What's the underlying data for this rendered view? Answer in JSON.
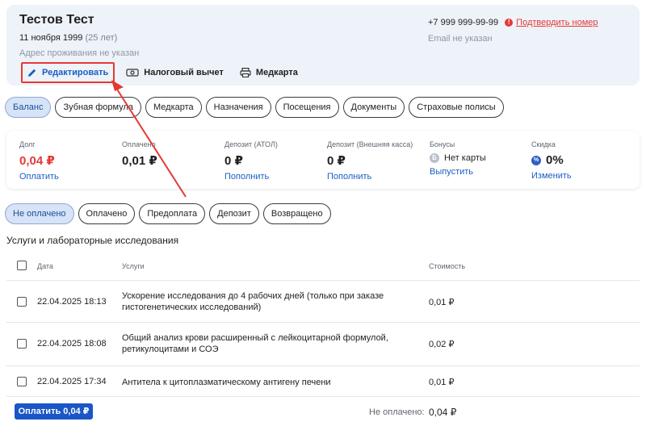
{
  "patient": {
    "name": "Тестов Тест",
    "dob": "11 ноября 1999",
    "age": "(25 лет)",
    "address": "Адрес проживания не указан",
    "phone": "+7 999 999-99-99",
    "confirm_phone": "Подтвердить номер",
    "email": "Email не указан"
  },
  "actions": {
    "edit": "Редактировать",
    "tax": "Налоговый вычет",
    "medcard": "Медкарта"
  },
  "tabs": [
    "Баланс",
    "Зубная формула",
    "Медкарта",
    "Назначения",
    "Посещения",
    "Документы",
    "Страховые полисы"
  ],
  "balance": {
    "debt": {
      "label": "Долг",
      "value": "0,04 ₽",
      "link": "Оплатить"
    },
    "paid": {
      "label": "Оплачено",
      "value": "0,01 ₽"
    },
    "deposit_atol": {
      "label": "Депозит (АТОЛ)",
      "value": "0 ₽",
      "link": "Пополнить"
    },
    "deposit_ext": {
      "label": "Депозит (Внешняя касса)",
      "value": "0 ₽",
      "link": "Пополнить"
    },
    "bonuses": {
      "label": "Бонусы",
      "value": "Нет карты",
      "link": "Выпустить"
    },
    "discount": {
      "label": "Скидка",
      "value": "0%",
      "link": "Изменить"
    }
  },
  "filters": [
    "Не оплачено",
    "Оплачено",
    "Предоплата",
    "Депозит",
    "Возвращено"
  ],
  "section_title": "Услуги и лабораторные исследования",
  "table": {
    "headers": {
      "date": "Дата",
      "services": "Услуги",
      "cost": "Стоимость"
    },
    "rows": [
      {
        "date": "22.04.2025 18:13",
        "service": "Ускорение исследования до 4 рабочих дней (только при заказе гистогенетических исследований)",
        "cost": "0,01 ₽"
      },
      {
        "date": "22.04.2025 18:08",
        "service": "Общий анализ крови расширенный с лейкоцитарной формулой, ретикулоцитами и СОЭ",
        "cost": "0,02 ₽"
      },
      {
        "date": "22.04.2025 17:34",
        "service": "Антитела к цитоплазматическому антигену печени",
        "cost": "0,01 ₽"
      }
    ]
  },
  "footer": {
    "pay_button": "Оплатить 0,04 ₽",
    "unpaid_label": "Не оплачено:",
    "unpaid_value": "0,04 ₽"
  },
  "colors": {
    "accent": "#1a56c6",
    "danger": "#e53935",
    "annotation": "#e53935"
  }
}
